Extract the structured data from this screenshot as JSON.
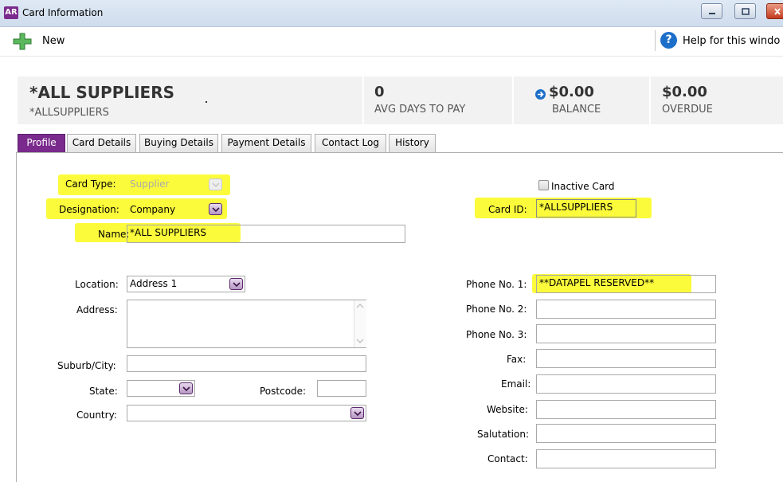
{
  "window": {
    "logo_text": "AR",
    "title": "Card Information"
  },
  "toolbar": {
    "new_label": "New",
    "help_label": "Help for this windo",
    "help_glyph": "?"
  },
  "summary": {
    "card_name": "*ALL SUPPLIERS",
    "card_id": "*ALLSUPPLIERS",
    "avg_days_value": "0",
    "avg_days_label": "AVG DAYS TO PAY",
    "balance_value": "$0.00",
    "balance_label": "BALANCE",
    "overdue_value": "$0.00",
    "overdue_label": "OVERDUE"
  },
  "tabs": [
    {
      "label": "Profile",
      "active": true
    },
    {
      "label": "Card Details",
      "active": false
    },
    {
      "label": "Buying Details",
      "active": false
    },
    {
      "label": "Payment Details",
      "active": false
    },
    {
      "label": "Contact Log",
      "active": false
    },
    {
      "label": "History",
      "active": false
    }
  ],
  "profile": {
    "card_type_label": "Card Type:",
    "card_type_value": "Supplier",
    "designation_label": "Designation:",
    "designation_value": "Company",
    "name_label": "Name:",
    "name_value": "*ALL SUPPLIERS",
    "inactive_label": "Inactive Card",
    "inactive_checked": false,
    "card_id_label": "Card ID:",
    "card_id_value": "*ALLSUPPLIERS",
    "location_label": "Location:",
    "location_value": "Address 1",
    "address_label": "Address:",
    "address_value": "",
    "suburb_label": "Suburb/City:",
    "suburb_value": "",
    "state_label": "State:",
    "state_value": "",
    "postcode_label": "Postcode:",
    "postcode_value": "",
    "country_label": "Country:",
    "country_value": "",
    "phone1_label": "Phone No. 1:",
    "phone1_value": "**DATAPEL RESERVED**",
    "phone2_label": "Phone No. 2:",
    "phone2_value": "",
    "phone3_label": "Phone No. 3:",
    "phone3_value": "",
    "fax_label": "Fax:",
    "fax_value": "",
    "email_label": "Email:",
    "email_value": "",
    "website_label": "Website:",
    "website_value": "",
    "salutation_label": "Salutation:",
    "salutation_value": "",
    "contact_label": "Contact:",
    "contact_value": ""
  },
  "colors": {
    "accent": "#7a2a8c",
    "highlight": "#fbfb3c",
    "link_blue": "#1c6fc9"
  }
}
